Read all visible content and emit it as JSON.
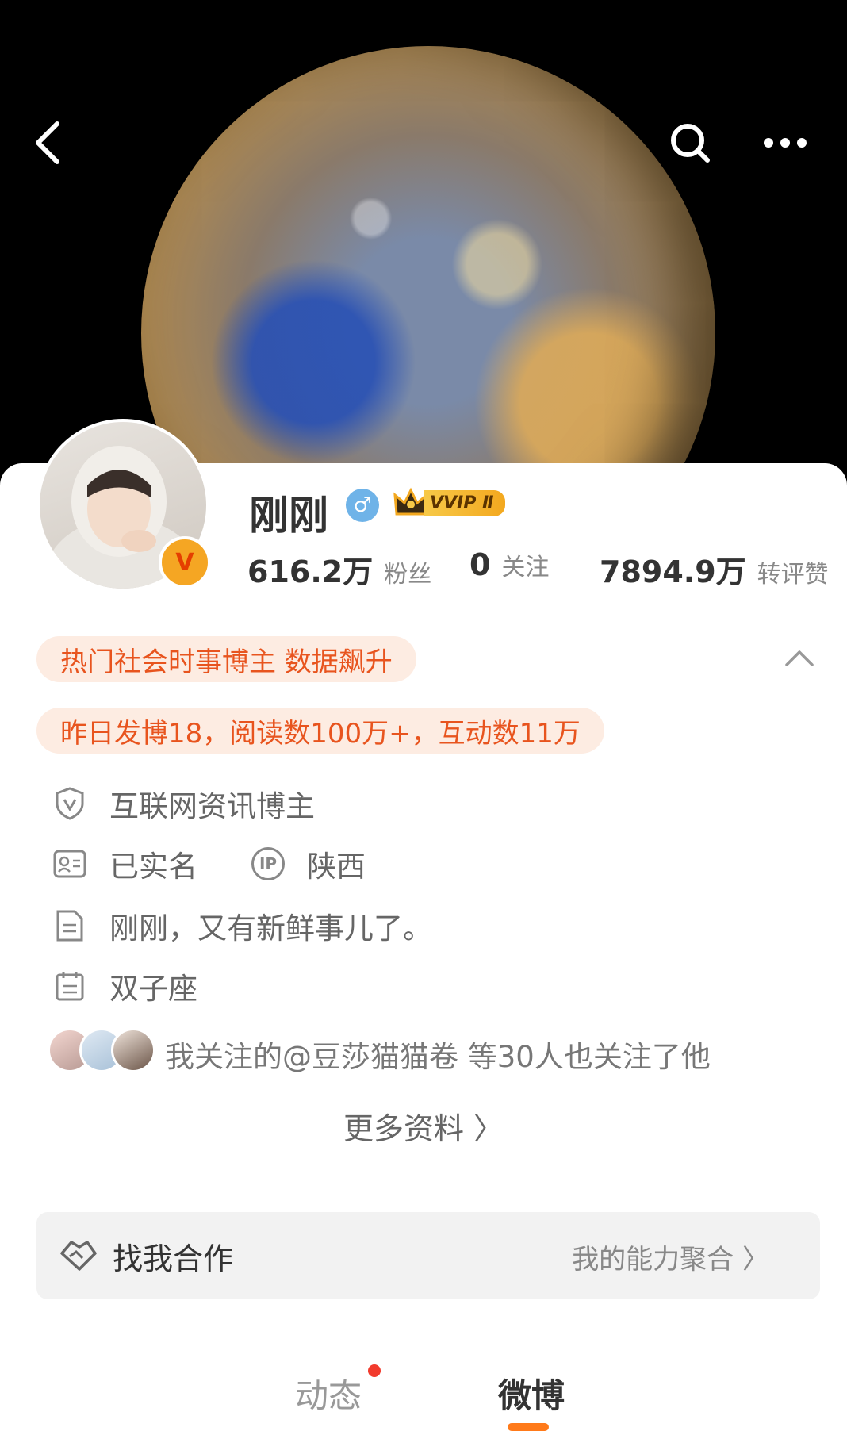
{
  "header": {
    "back_icon": "back-arrow-icon",
    "search_icon": "search-icon",
    "more_icon": "more-dots-icon"
  },
  "profile": {
    "name": "刚刚",
    "gender_symbol": "♂",
    "verified_badge": "V",
    "vvip_label": "VVIP Ⅱ"
  },
  "stats": [
    {
      "value": "616.2万",
      "label": "粉丝"
    },
    {
      "value": "0",
      "label": "关注"
    },
    {
      "value": "7894.9万",
      "label": "转评赞"
    }
  ],
  "tags": {
    "hot": "热门社会时事博主 数据飙升",
    "yesterday": "昨日发博18，阅读数100万+，互动数11万"
  },
  "info": {
    "category": "互联网资讯博主",
    "realname": "已实名",
    "ip_badge": "IP",
    "ip_location": "陕西",
    "bio": "刚刚，又有新鲜事儿了。",
    "zodiac": "双子座",
    "mutual": "我关注的@豆莎猫猫卷 等30人也关注了他"
  },
  "more_info": "更多资料 〉",
  "cooperation": {
    "title": "找我合作",
    "subtitle": "我的能力聚合 〉"
  },
  "tabs": [
    {
      "label": "动态"
    },
    {
      "label": "微博"
    }
  ],
  "colors": {
    "accent": "#ff7a1a",
    "tag_bg": "#fdece2",
    "tag_text": "#e8541e",
    "gender": "#6fb3e8"
  }
}
